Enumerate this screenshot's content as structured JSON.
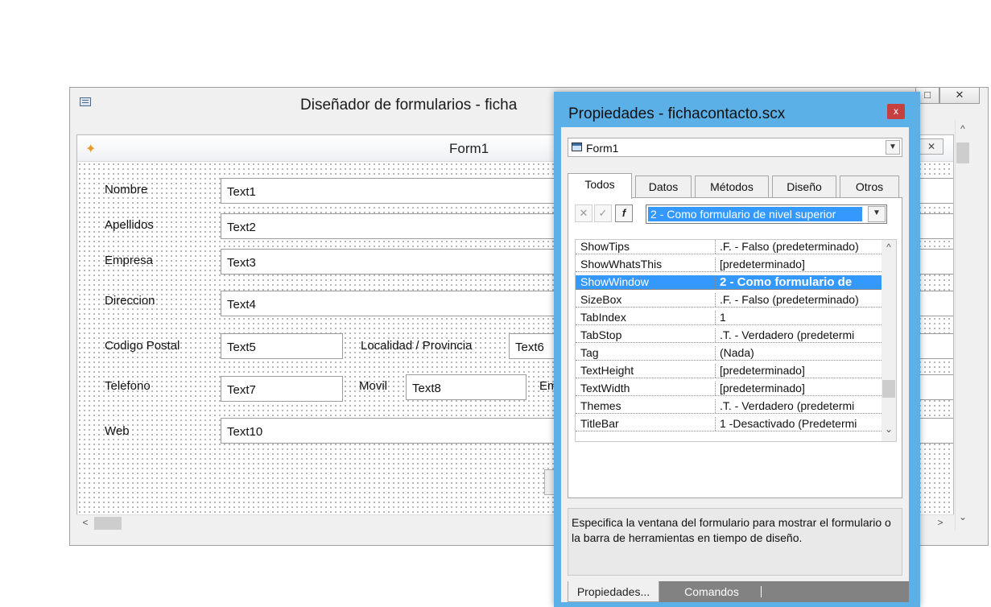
{
  "designer": {
    "title": "Diseñador de formularios - ficha",
    "form_title": "Form1",
    "window_buttons": [
      "□",
      "✕"
    ],
    "form_close": "✕",
    "fields": [
      {
        "label": "Nombre",
        "value": "Text1"
      },
      {
        "label": "Apellidos",
        "value": "Text2"
      },
      {
        "label": "Empresa",
        "value": "Text3"
      },
      {
        "label": "Direccion",
        "value": "Text4"
      },
      {
        "label": "Codigo Postal",
        "value": "Text5"
      },
      {
        "label": "Localidad / Provincia",
        "value": "Text6"
      },
      {
        "label": "Telefono",
        "value": "Text7"
      },
      {
        "label": "Movil",
        "value": "Text8"
      },
      {
        "label": "Em",
        "value": ""
      },
      {
        "label": "Web",
        "value": "Text10"
      }
    ]
  },
  "properties": {
    "title": "Propiedades - fichacontacto.scx",
    "close": "x",
    "object": "Form1",
    "tabs": [
      "Todos",
      "Datos",
      "Métodos",
      "Diseño",
      "Otros"
    ],
    "value_combo": "2 - Como formulario de nivel superior",
    "rows": [
      {
        "name": "ShowTips",
        "value": ".F. - Falso (predeterminado)"
      },
      {
        "name": "ShowWhatsThis",
        "value": "[predeterminado]"
      },
      {
        "name": "ShowWindow",
        "value": "2 - Como formulario de"
      },
      {
        "name": "SizeBox",
        "value": ".F. - Falso (predeterminado)"
      },
      {
        "name": "TabIndex",
        "value": "1"
      },
      {
        "name": "TabStop",
        "value": ".T. - Verdadero (predetermi"
      },
      {
        "name": "Tag",
        "value": "(Nada)"
      },
      {
        "name": "TextHeight",
        "value": "[predeterminado]"
      },
      {
        "name": "TextWidth",
        "value": "[predeterminado]"
      },
      {
        "name": "Themes",
        "value": ".T. - Verdadero (predetermi"
      },
      {
        "name": "TitleBar",
        "value": "1 -Desactivado (Predetermi"
      }
    ],
    "description": "Especifica la ventana del formulario para mostrar el formulario o la barra de herramientas en tiempo de diseño.",
    "bottom_tabs": [
      "Propiedades...",
      "Comandos"
    ]
  }
}
